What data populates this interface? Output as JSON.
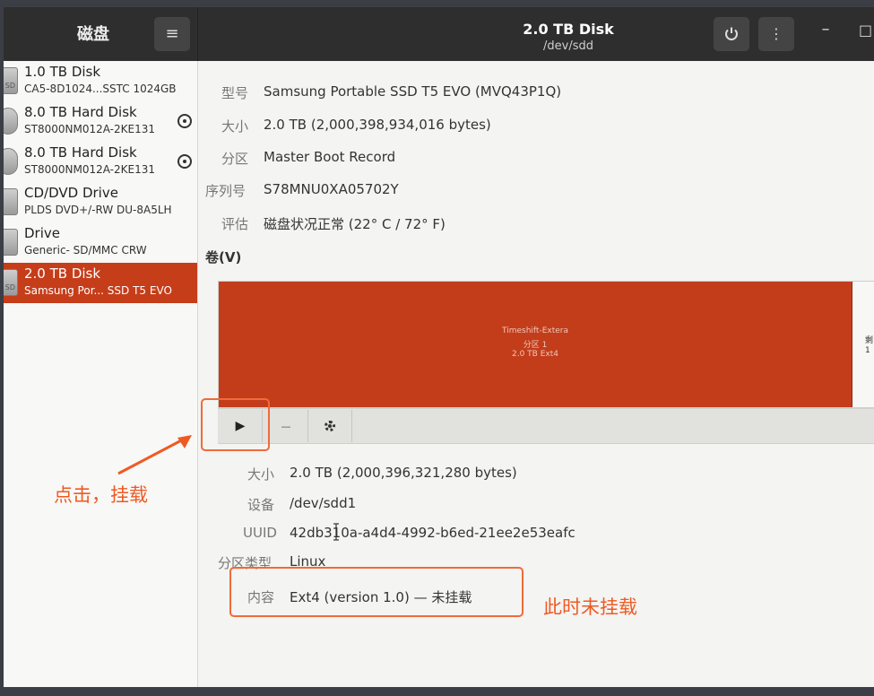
{
  "header": {
    "sidebar_title": "磁盘",
    "menu_icon": "hamburger-menu-icon",
    "title": "2.0 TB Disk",
    "subtitle": "/dev/sdd",
    "power_icon": "power-icon",
    "more_icon": "vertical-dots-icon",
    "minimize_label": "–",
    "maximize_label": "□"
  },
  "sidebar": {
    "items": [
      {
        "name": "1.0 TB Disk",
        "sub": "CA5-8D1024...SSTC 1024GB",
        "icon": "SD"
      },
      {
        "name": "8.0 TB Hard Disk",
        "sub": "ST8000NM012A-2KE131",
        "icon": ""
      },
      {
        "name": "8.0 TB Hard Disk",
        "sub": "ST8000NM012A-2KE131",
        "icon": ""
      },
      {
        "name": "CD/DVD Drive",
        "sub": "PLDS DVD+/-RW DU-8A5LH",
        "icon": ""
      },
      {
        "name": "Drive",
        "sub": "Generic- SD/MMC CRW",
        "icon": ""
      },
      {
        "name": "2.0 TB Disk",
        "sub": "Samsung Por... SSD T5 EVO",
        "icon": "SD"
      }
    ]
  },
  "disk": {
    "model_label": "型号",
    "model": "Samsung Portable SSD T5 EVO (MVQ43P1Q)",
    "size_label": "大小",
    "size": "2.0 TB (2,000,398,934,016 bytes)",
    "partitioning_label": "分区",
    "partitioning": "Master Boot Record",
    "serial_label": "序列号",
    "serial": "S78MNU0XA05702Y",
    "assessment_label": "评估",
    "assessment": "磁盘状况正常 (22° C / 72° F)"
  },
  "volumes": {
    "heading": "卷(V)",
    "partition": {
      "line1": "Timeshift-Extera",
      "line2": "分区 1",
      "line3": "2.0 TB Ext4"
    },
    "free": {
      "line1": "剩",
      "line2": "1"
    }
  },
  "toolbar": {
    "play_label": "▶",
    "minus_label": "—",
    "gear_icon": "gear-icon"
  },
  "partition_details": {
    "size_label": "大小",
    "size": "2.0 TB (2,000,396,321,280 bytes)",
    "device_label": "设备",
    "device": "/dev/sdd1",
    "uuid_label": "UUID",
    "uuid": "42db310a-a4d4-4992-b6ed-21ee2e53eafc",
    "type_label": "分区类型",
    "type": "Linux",
    "contents_label": "内容",
    "contents": "Ext4 (version 1.0) — 未挂载"
  },
  "annotations": {
    "click_mount": "点击，挂载",
    "not_mounted": "此时未挂载",
    "color": "#ee5a24"
  }
}
